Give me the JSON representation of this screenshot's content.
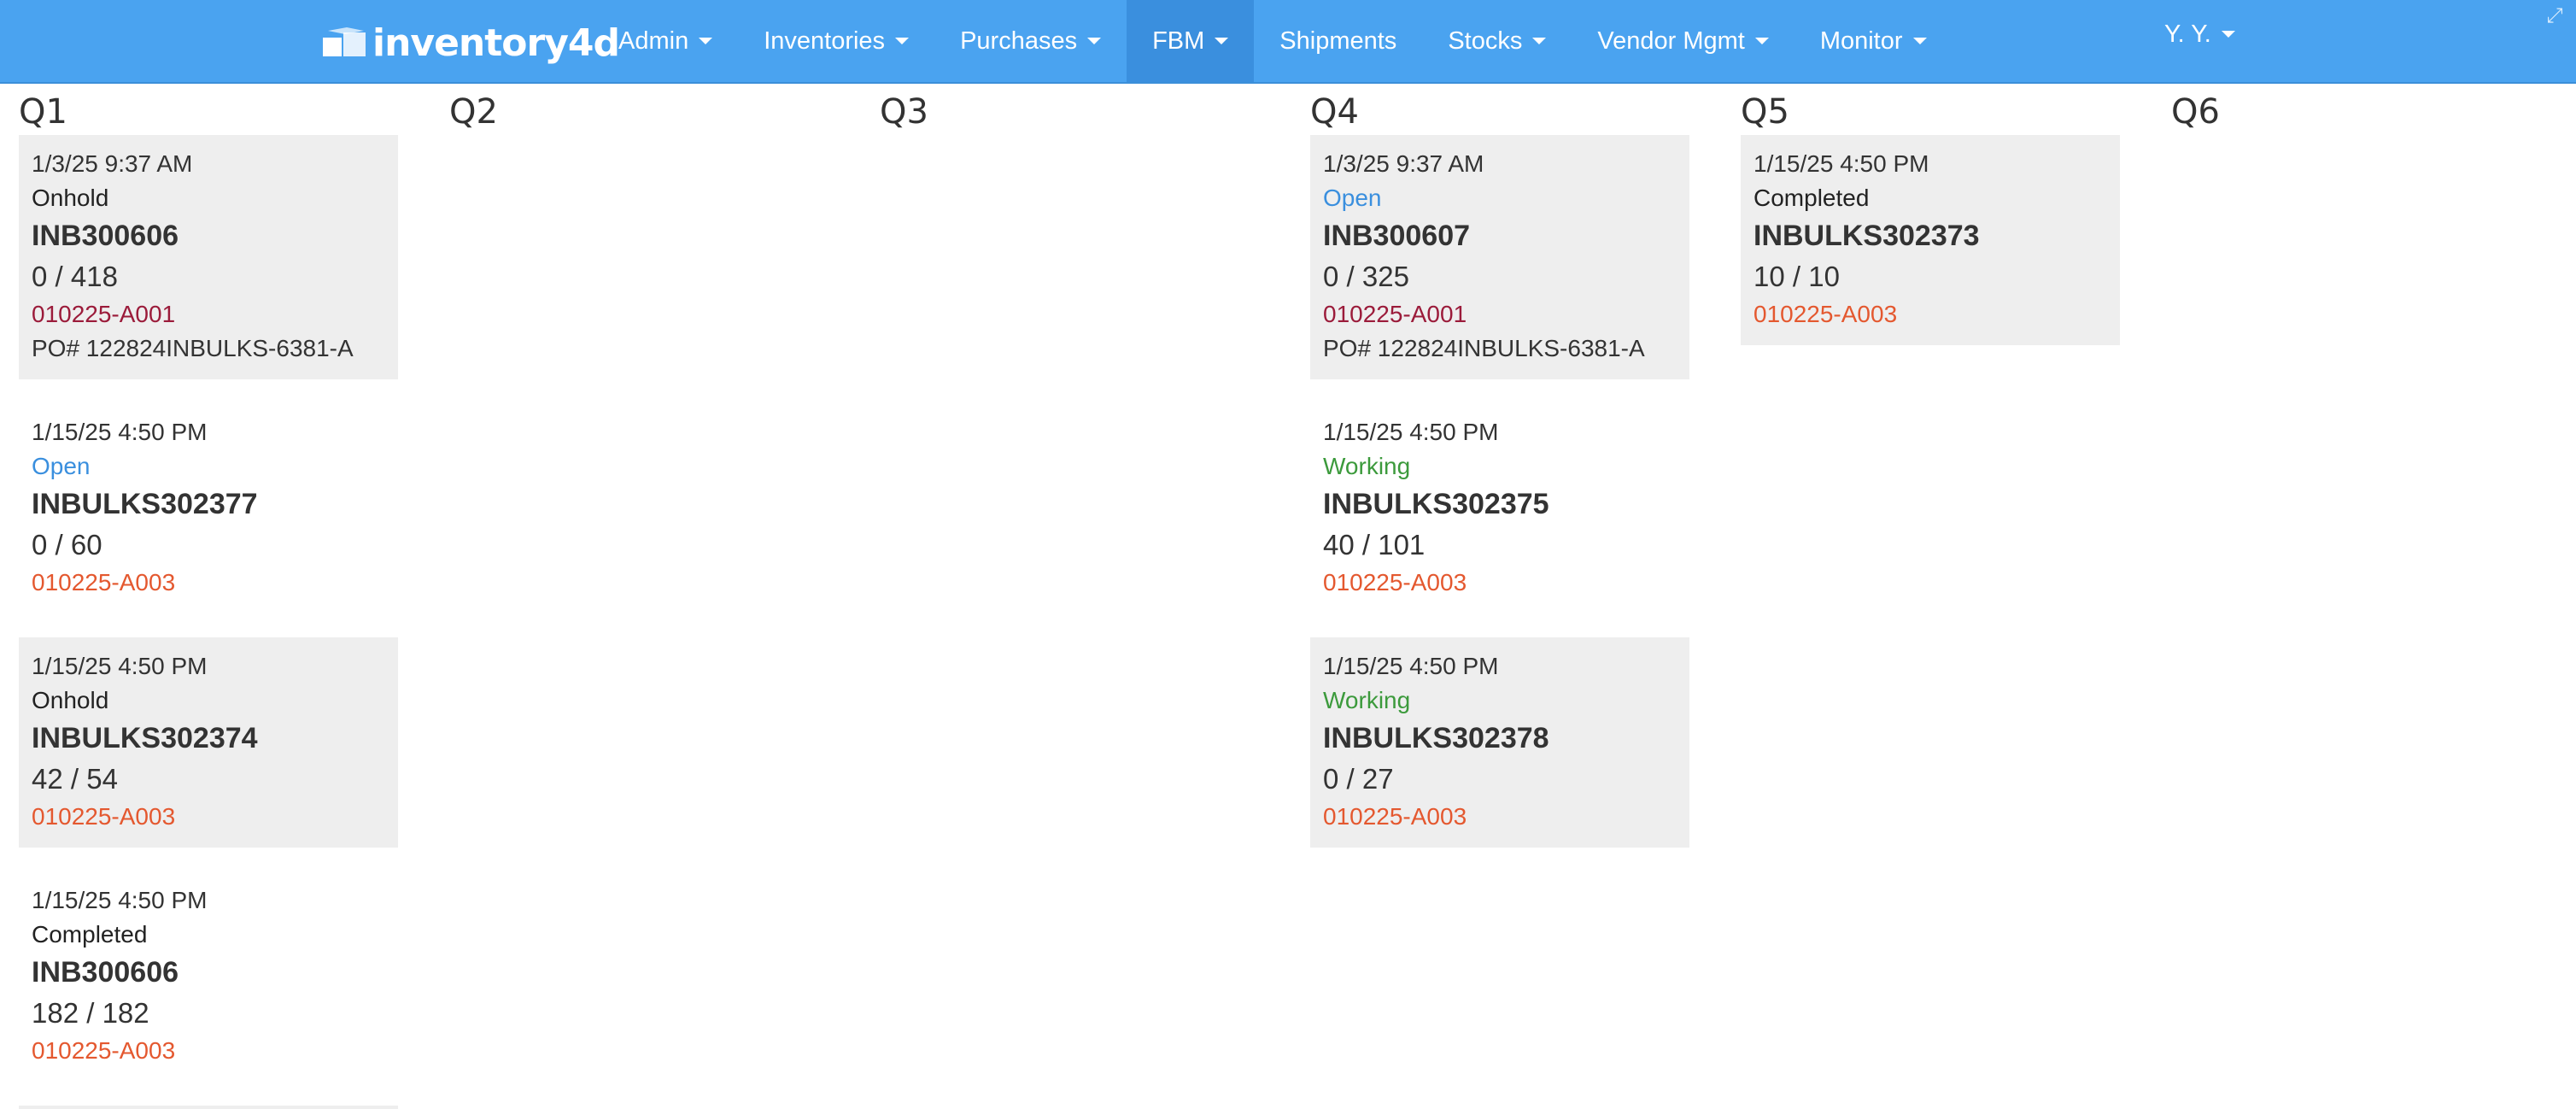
{
  "header": {
    "brand": "inventory4d",
    "nav": [
      {
        "label": "Admin",
        "dropdown": true
      },
      {
        "label": "Inventories",
        "dropdown": true
      },
      {
        "label": "Purchases",
        "dropdown": true
      },
      {
        "label": "FBM",
        "dropdown": true,
        "active": true
      },
      {
        "label": "Shipments",
        "dropdown": false
      },
      {
        "label": "Stocks",
        "dropdown": true
      },
      {
        "label": "Vendor Mgmt",
        "dropdown": true
      },
      {
        "label": "Monitor",
        "dropdown": true
      }
    ],
    "user": "Y. Y.",
    "colors": {
      "navbar": "#4aa3f0",
      "active_tab": "#3a8fde"
    }
  },
  "columns": [
    {
      "title": "Q1",
      "cards": [
        {
          "date": "1/3/25 9:37 AM",
          "status": "Onhold",
          "id": "INB300606",
          "qty": "0 / 418",
          "code": "010225-A001",
          "po": "PO# 122824INBULKS-6381-A"
        },
        {
          "date": "1/15/25 4:50 PM",
          "status": "Open",
          "id": "INBULKS302377",
          "qty": "0 / 60",
          "code": "010225-A003"
        },
        {
          "date": "1/15/25 4:50 PM",
          "status": "Onhold",
          "id": "INBULKS302374",
          "qty": "42 / 54",
          "code": "010225-A003"
        },
        {
          "date": "1/15/25 4:50 PM",
          "status": "Completed",
          "id": "INB300606",
          "qty": "182 / 182",
          "code": "010225-A003"
        }
      ]
    },
    {
      "title": "Q2",
      "cards": []
    },
    {
      "title": "Q3",
      "cards": []
    },
    {
      "title": "Q4",
      "cards": [
        {
          "date": "1/3/25 9:37 AM",
          "status": "Open",
          "id": "INB300607",
          "qty": "0 / 325",
          "code": "010225-A001",
          "po": "PO# 122824INBULKS-6381-A"
        },
        {
          "date": "1/15/25 4:50 PM",
          "status": "Working",
          "id": "INBULKS302375",
          "qty": "40 / 101",
          "code": "010225-A003"
        },
        {
          "date": "1/15/25 4:50 PM",
          "status": "Working",
          "id": "INBULKS302378",
          "qty": "0 / 27",
          "code": "010225-A003"
        }
      ]
    },
    {
      "title": "Q5",
      "cards": [
        {
          "date": "1/15/25 4:50 PM",
          "status": "Completed",
          "id": "INBULKS302373",
          "qty": "10 / 10",
          "code": "010225-A003"
        }
      ]
    },
    {
      "title": "Q6",
      "cards": []
    }
  ],
  "status_colors": {
    "Onhold": "#222222",
    "Open": "#3a8fde",
    "Working": "#3c9a3c",
    "Completed": "#222222"
  },
  "code_colors": {
    "010225-A001": "#9b1b3a",
    "010225-A003": "#e4582f"
  },
  "icons": {
    "brand": "boxes-logo-icon",
    "dropdown": "caret-down-icon",
    "corner": "resize-arrows-icon"
  }
}
